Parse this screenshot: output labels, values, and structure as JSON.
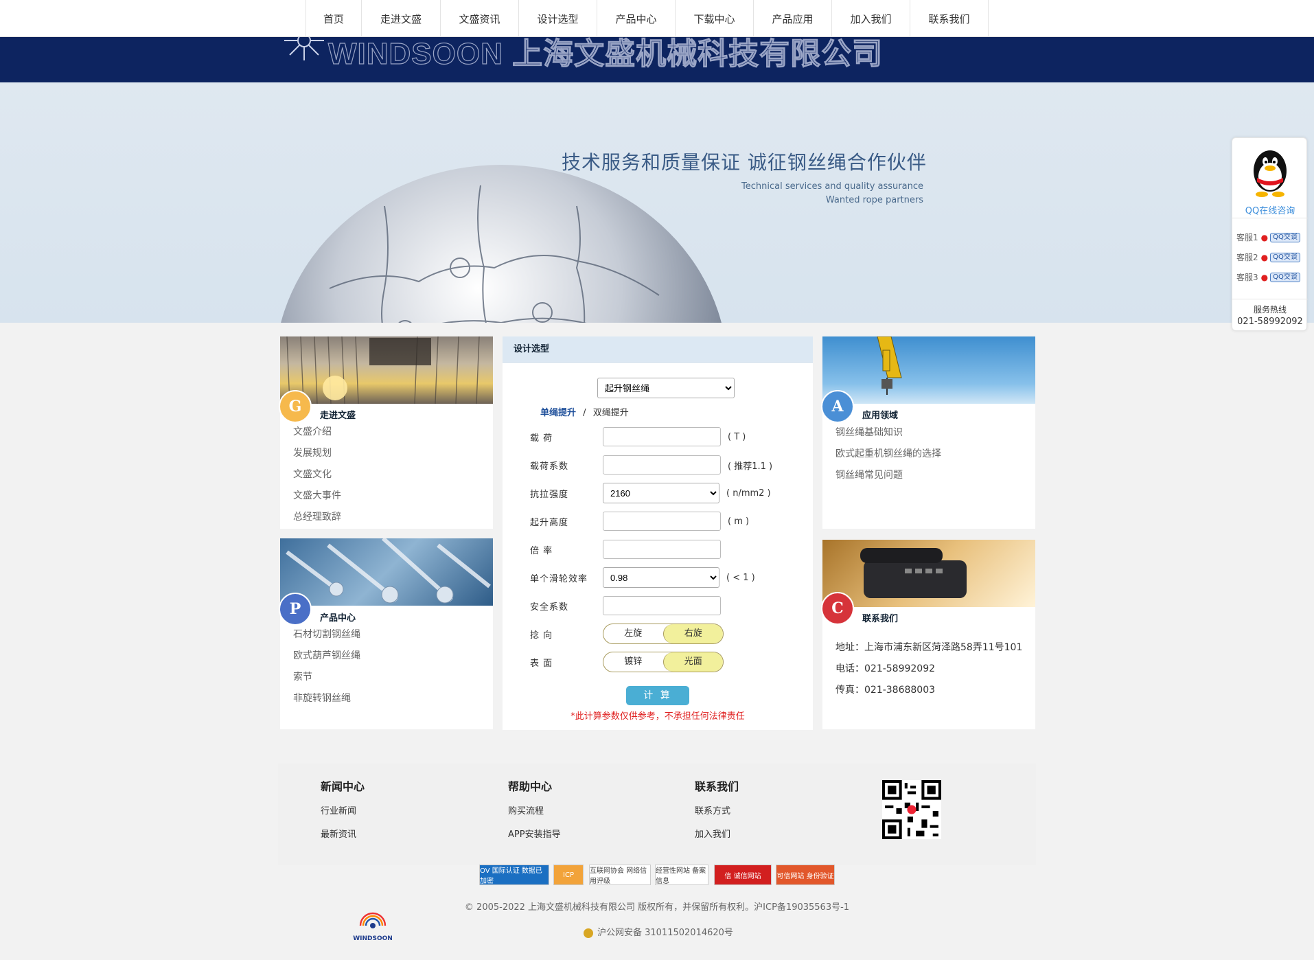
{
  "nav": [
    "首页",
    "走进文盛",
    "文盛资讯",
    "设计选型",
    "产品中心",
    "下载中心",
    "产品应用",
    "加入我们",
    "联系我们"
  ],
  "header": {
    "logo_text": "WINDSOON 上海文盛机械科技有限公司"
  },
  "banner": {
    "slogan_cn": "技术服务和质量保证  诚征钢丝绳合作伙伴",
    "slogan_en_1": "Technical services and quality assurance",
    "slogan_en_2": "Wanted rope partners"
  },
  "about": {
    "badge": "G",
    "title": "走进文盛",
    "items": [
      "文盛介绍",
      "发展规划",
      "文盛文化",
      "文盛大事件",
      "总经理致辞"
    ]
  },
  "products": {
    "badge": "P",
    "title": "产品中心",
    "items": [
      "石材切割钢丝绳",
      "欧式葫芦钢丝绳",
      "索节",
      "非旋转钢丝绳"
    ]
  },
  "apps": {
    "badge": "A",
    "title": "应用领域",
    "items": [
      "钢丝绳基础知识",
      "欧式起重机钢丝绳的选择",
      "钢丝绳常见问题"
    ]
  },
  "contact": {
    "badge": "C",
    "title": "联系我们",
    "address": "地址：上海市浦东新区菏泽路58弄11号101",
    "phone": "电话：021-58992092",
    "fax": "传真：021-38688003"
  },
  "calc": {
    "title": "设计选型",
    "type_select": "起升钢丝绳",
    "mode_single": "单绳提升",
    "mode_sep": "/",
    "mode_double": "双绳提升",
    "load_label": "载    荷",
    "load_unit": "( T )",
    "load_factor_label": "载荷系数",
    "load_factor_unit": "( 推荐1.1 )",
    "tensile_label": "抗拉强度",
    "tensile_value": "2160",
    "tensile_unit": "( n/mm2 )",
    "height_label": "起升高度",
    "height_unit": "( m )",
    "ratio_label": "倍    率",
    "pulley_label": "单个滑轮效率",
    "pulley_value": "0.98",
    "pulley_unit": "( < 1 )",
    "safety_label": "安全系数",
    "lay_label": "捻    向",
    "lay_left": "左旋",
    "lay_right": "右旋",
    "surface_label": "表    面",
    "surface_a": "镀锌",
    "surface_b": "光面",
    "button": "计 算",
    "disclaimer": "*此计算参数仅供参考，不承担任何法律责任"
  },
  "footer": {
    "news": {
      "title": "新闻中心",
      "items": [
        "行业新闻",
        "最新资讯"
      ]
    },
    "help": {
      "title": "帮助中心",
      "items": [
        "购买流程",
        "APP安装指导"
      ]
    },
    "contact": {
      "title": "联系我们",
      "items": [
        "联系方式",
        "加入我们"
      ]
    },
    "badges": [
      "OV 国际认证 数据已加密",
      "ICP",
      "互联网协会 网络信用评级",
      "经营性网站 备案信息",
      "信 诚信网站",
      "可信网站 身份验证"
    ],
    "copyright": "© 2005-2022 上海文盛机械科技有限公司 版权所有，并保留所有权利。沪ICP备19035563号-1",
    "beian": "沪公网安备 31011502014620号",
    "logo_small": "WINDSOON"
  },
  "qq": {
    "caption": "QQ在线咨询",
    "services": [
      "客服1",
      "客服2",
      "客服3"
    ],
    "chat_label": "QQ交谈",
    "hotline_label": "服务热线",
    "hotline": "021-58992092"
  }
}
